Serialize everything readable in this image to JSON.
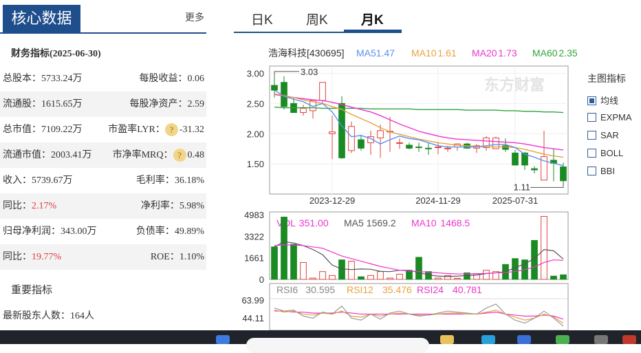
{
  "left": {
    "core_title": "核心数据",
    "more": "更多",
    "fin_title": "财务指标(2025-06-30)",
    "rows": [
      {
        "l": "总股本：5733.24万",
        "r": "每股收益：0.06",
        "shade": false
      },
      {
        "l": "流通股：1615.65万",
        "r": "每股净资产：2.59",
        "shade": true
      },
      {
        "l": "总市值：7109.22万",
        "r_label": "市盈率LYR：",
        "r_value": "-31.32",
        "q": "?",
        "shade": false
      },
      {
        "l": "流通市值：2003.41万",
        "r_label": "市净率MRQ：",
        "r_value": "0.48",
        "q": "?",
        "shade": true
      },
      {
        "l": "收入：5739.67万",
        "r": "毛利率：36.18%",
        "shade": false
      },
      {
        "l_label": "同比：",
        "l_value": "2.17%",
        "r": "净利率：5.98%",
        "shade": true
      },
      {
        "l": "归母净利润：343.00万",
        "r": "负债率：49.89%",
        "shade": false
      },
      {
        "l_label": "同比：",
        "l_value": "19.77%",
        "r": "ROE：1.10%",
        "shade": true
      }
    ],
    "key_title": "重要指标",
    "holders": "最新股东人数：164人"
  },
  "tabs": [
    "日K",
    "周K",
    "月K"
  ],
  "active_tab": "月K",
  "main_indicator": {
    "title": "主图指标",
    "options": [
      {
        "label": "均线",
        "checked": true
      },
      {
        "label": "EXPMA",
        "checked": false
      },
      {
        "label": "SAR",
        "checked": false
      },
      {
        "label": "BOLL",
        "checked": false
      },
      {
        "label": "BBI",
        "checked": false
      }
    ]
  },
  "colors": {
    "up": "#e0413b",
    "down": "#1a8a23",
    "ma5": "#5b8ff0",
    "ma10": "#e6a23c",
    "ma20": "#ee33cc",
    "ma60": "#2fa33a",
    "accent": "#1f4e8c"
  },
  "chart_data": [
    {
      "type": "candlestick",
      "title": "浩海科技[430695]",
      "legend": [
        {
          "name": "MA5",
          "value": "1.47",
          "color": "#5b8ff0"
        },
        {
          "name": "MA10",
          "value": "1.61",
          "color": "#e6a23c"
        },
        {
          "name": "MA20",
          "value": "1.73",
          "color": "#ee33cc"
        },
        {
          "name": "MA60",
          "value": "2.35",
          "color": "#2fa33a"
        }
      ],
      "yticks": [
        "3.00",
        "2.50",
        "2.00",
        "1.50"
      ],
      "ylim": [
        1.0,
        3.12
      ],
      "xticks": [
        {
          "label": "2023-12-29",
          "i": 6
        },
        {
          "label": "2024-11-29",
          "i": 17
        },
        {
          "label": "2025-07-31",
          "i": 25
        }
      ],
      "watermark": "东方财富",
      "annotations": [
        {
          "text": "3.03",
          "i": 0,
          "y": 3.03
        },
        {
          "text": "1.11",
          "i": 27,
          "y": 1.11
        }
      ],
      "candles": [
        {
          "o": 2.8,
          "h": 3.03,
          "l": 2.6,
          "c": 2.72
        },
        {
          "o": 2.85,
          "h": 2.95,
          "l": 2.4,
          "c": 2.45
        },
        {
          "o": 2.5,
          "h": 2.6,
          "l": 2.35,
          "c": 2.35
        },
        {
          "o": 2.35,
          "h": 2.48,
          "l": 2.3,
          "c": 2.42
        },
        {
          "o": 2.38,
          "h": 2.55,
          "l": 2.25,
          "c": 2.55
        },
        {
          "o": 2.55,
          "h": 2.85,
          "l": 2.5,
          "c": 2.85
        },
        {
          "o": 2.0,
          "h": 2.3,
          "l": 1.58,
          "c": 2.03
        },
        {
          "o": 2.5,
          "h": 2.62,
          "l": 1.58,
          "c": 1.6
        },
        {
          "o": 1.72,
          "h": 2.2,
          "l": 1.68,
          "c": 2.12
        },
        {
          "o": 1.9,
          "h": 1.98,
          "l": 1.72,
          "c": 1.76
        },
        {
          "o": 1.85,
          "h": 2.05,
          "l": 1.65,
          "c": 1.95
        },
        {
          "o": 1.93,
          "h": 2.15,
          "l": 1.6,
          "c": 2.05
        },
        {
          "o": 2.04,
          "h": 2.28,
          "l": 1.7,
          "c": 2.04
        },
        {
          "o": 1.85,
          "h": 1.92,
          "l": 1.75,
          "c": 1.85
        },
        {
          "o": 1.81,
          "h": 1.85,
          "l": 1.74,
          "c": 1.76
        },
        {
          "o": 1.78,
          "h": 1.85,
          "l": 1.7,
          "c": 1.77
        },
        {
          "o": 1.76,
          "h": 1.85,
          "l": 1.65,
          "c": 1.75
        },
        {
          "o": 1.78,
          "h": 1.86,
          "l": 1.66,
          "c": 1.78
        },
        {
          "o": 1.76,
          "h": 1.8,
          "l": 1.7,
          "c": 1.76
        },
        {
          "o": 1.78,
          "h": 1.84,
          "l": 1.72,
          "c": 1.83
        },
        {
          "o": 1.83,
          "h": 1.85,
          "l": 1.75,
          "c": 1.76
        },
        {
          "o": 1.76,
          "h": 1.83,
          "l": 1.68,
          "c": 1.8
        },
        {
          "o": 1.77,
          "h": 1.96,
          "l": 1.72,
          "c": 1.93
        },
        {
          "o": 1.75,
          "h": 1.95,
          "l": 1.75,
          "c": 1.93
        },
        {
          "o": 1.8,
          "h": 1.92,
          "l": 1.7,
          "c": 1.74
        },
        {
          "o": 1.68,
          "h": 1.73,
          "l": 1.48,
          "c": 1.48
        },
        {
          "o": 1.68,
          "h": 1.7,
          "l": 1.4,
          "c": 1.48
        },
        {
          "o": 1.42,
          "h": 1.46,
          "l": 1.34,
          "c": 1.4
        },
        {
          "o": 1.23,
          "h": 2.05,
          "l": 1.23,
          "c": 1.62
        },
        {
          "o": 1.56,
          "h": 1.76,
          "l": 1.21,
          "c": 1.51
        },
        {
          "o": 1.45,
          "h": 1.52,
          "l": 1.11,
          "c": 1.22
        }
      ],
      "ma5": [
        2.72,
        2.62,
        2.57,
        2.53,
        2.45,
        2.5,
        2.36,
        2.13,
        1.95,
        1.97,
        1.92,
        1.83,
        1.9,
        1.96,
        1.92,
        1.9,
        1.85,
        1.8,
        1.78,
        1.78,
        1.78,
        1.78,
        1.8,
        1.82,
        1.82,
        1.77,
        1.66,
        1.61,
        1.55,
        1.51,
        1.47
      ],
      "ma10": [
        2.66,
        2.63,
        2.6,
        2.56,
        2.53,
        2.5,
        2.45,
        2.4,
        2.32,
        2.25,
        2.18,
        2.1,
        2.03,
        1.99,
        1.95,
        1.91,
        1.88,
        1.85,
        1.83,
        1.81,
        1.8,
        1.79,
        1.78,
        1.78,
        1.78,
        1.77,
        1.74,
        1.7,
        1.66,
        1.63,
        1.61
      ],
      "ma20": [
        2.65,
        2.62,
        2.6,
        2.58,
        2.56,
        2.55,
        2.52,
        2.48,
        2.44,
        2.4,
        2.36,
        2.3,
        2.23,
        2.16,
        2.1,
        2.04,
        2.0,
        1.96,
        1.93,
        1.91,
        1.9,
        1.89,
        1.88,
        1.87,
        1.86,
        1.85,
        1.83,
        1.8,
        1.77,
        1.75,
        1.73
      ],
      "ma60": [
        2.44,
        2.43,
        2.43,
        2.43,
        2.43,
        2.42,
        2.42,
        2.42,
        2.42,
        2.42,
        2.41,
        2.41,
        2.41,
        2.41,
        2.41,
        2.4,
        2.4,
        2.4,
        2.4,
        2.4,
        2.39,
        2.39,
        2.39,
        2.39,
        2.38,
        2.38,
        2.37,
        2.37,
        2.36,
        2.36,
        2.35
      ]
    },
    {
      "type": "bar",
      "legend": [
        {
          "name": "VOL",
          "value": "351.00",
          "color": "#ee33cc"
        },
        {
          "name": "MA5",
          "value": "1569.2",
          "color": "#555555"
        },
        {
          "name": "MA10",
          "value": "1468.5",
          "color": "#ee33cc"
        }
      ],
      "yticks": [
        "4983",
        "3322",
        "1661",
        "0"
      ],
      "ylim": [
        0,
        4983
      ],
      "values": [
        2500,
        4800,
        2700,
        1300,
        100,
        600,
        300,
        1500,
        1400,
        200,
        300,
        600,
        100,
        400,
        700,
        1700,
        600,
        100,
        300,
        80,
        500,
        450,
        700,
        600,
        1150,
        1600,
        1500,
        3000,
        4850,
        250,
        351
      ],
      "ma5": [
        2500,
        2900,
        2800,
        2600,
        2300,
        1900,
        1100,
        800,
        760,
        800,
        780,
        620,
        600,
        700,
        700,
        520,
        350,
        250,
        220,
        250,
        300,
        330,
        450,
        500,
        600,
        900,
        1200,
        1600,
        2300,
        2200,
        1569
      ],
      "ma10": [
        2600,
        2650,
        2650,
        2600,
        2500,
        2400,
        2100,
        1800,
        1600,
        1400,
        1200,
        1000,
        850,
        700,
        650,
        600,
        560,
        500,
        450,
        420,
        420,
        430,
        460,
        500,
        540,
        600,
        750,
        950,
        1300,
        1500,
        1468
      ]
    },
    {
      "type": "line",
      "legend": [
        {
          "name": "RSI6",
          "value": "30.595",
          "color": "#888888"
        },
        {
          "name": "RSI12",
          "value": "35.476",
          "color": "#e6a23c"
        },
        {
          "name": "RSI24",
          "value": "40.781",
          "color": "#ee33cc"
        }
      ],
      "yticks": [
        "63.99",
        "44.11"
      ],
      "ylim": [
        40,
        66
      ],
      "rsi6": [
        58,
        55,
        56,
        50,
        48,
        54,
        52,
        60,
        48,
        46,
        52,
        47,
        53,
        55,
        52,
        50,
        51,
        53,
        55,
        54,
        53,
        52,
        58,
        62,
        52,
        46,
        43,
        48,
        55,
        48,
        40
      ],
      "rsi12": [
        56,
        54,
        55,
        52,
        51,
        53,
        52,
        55,
        50,
        49,
        52,
        50,
        52,
        53,
        52,
        51,
        51,
        52,
        53,
        53,
        52,
        52,
        54,
        56,
        52,
        49,
        46,
        48,
        52,
        49,
        43
      ],
      "rsi24": [
        55,
        55,
        54,
        54,
        53,
        53,
        53,
        54,
        53,
        52,
        52,
        52,
        52,
        52,
        52,
        52,
        52,
        52,
        52,
        52,
        52,
        52,
        53,
        54,
        52,
        51,
        50,
        50,
        51,
        50,
        47
      ]
    }
  ],
  "taskbar": {}
}
